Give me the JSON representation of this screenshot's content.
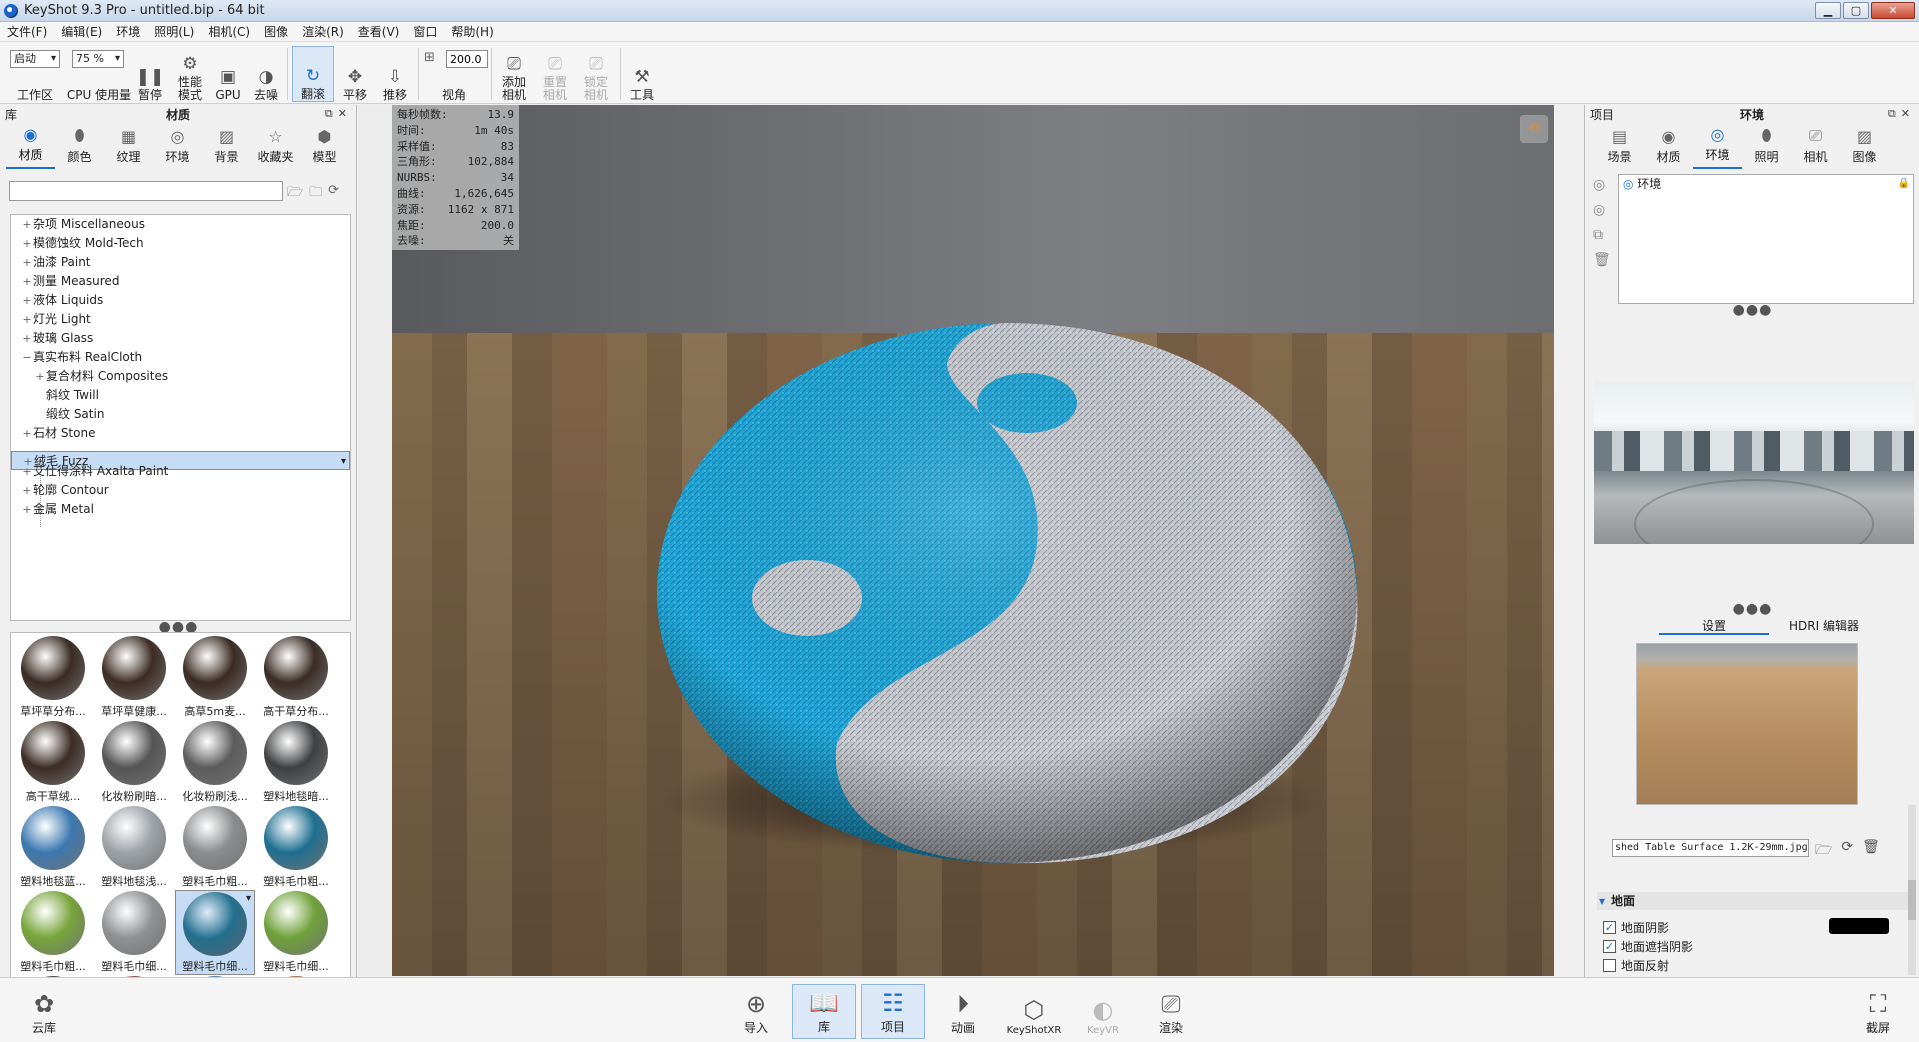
{
  "window": {
    "title": "KeyShot 9.3 Pro  - untitled.bip  - 64 bit",
    "min": "▁",
    "max": "▢",
    "close": "✕"
  },
  "menu": [
    "文件(F)",
    "编辑(E)",
    "环境",
    "照明(L)",
    "相机(C)",
    "图像",
    "渲染(R)",
    "查看(V)",
    "窗口",
    "帮助(H)"
  ],
  "toolbar": {
    "workspace_select": "启动",
    "workspace_label": "工作区",
    "cpu_select": "75 %",
    "cpu_label": "CPU 使用量",
    "pause": "暂停",
    "perf_mode": "性能\n模式",
    "gpu": "GPU",
    "denoise": "去噪",
    "tumble": "翻滚",
    "pan": "平移",
    "dolly": "推移",
    "fov_value": "200.0",
    "fov_label": "视角",
    "add_camera": "添加\n相机",
    "reset_camera": "重置\n相机",
    "lock_camera": "锁定\n相机",
    "tools": "工具"
  },
  "library": {
    "left_label": "库",
    "title": "材质",
    "tabs": [
      "材质",
      "颜色",
      "纹理",
      "环境",
      "背景",
      "收藏夹",
      "模型"
    ],
    "search_placeholder": "",
    "tree": [
      {
        "label": "杂项 Miscellaneous",
        "pm": "+",
        "indent": 0
      },
      {
        "label": "模德蚀纹 Mold-Tech",
        "pm": "+",
        "indent": 0
      },
      {
        "label": "油漆 Paint",
        "pm": "+",
        "indent": 0
      },
      {
        "label": "测量 Measured",
        "pm": "+",
        "indent": 0
      },
      {
        "label": "液体 Liquids",
        "pm": "+",
        "indent": 0
      },
      {
        "label": "灯光 Light",
        "pm": "+",
        "indent": 0
      },
      {
        "label": "玻璃 Glass",
        "pm": "+",
        "indent": 0
      },
      {
        "label": "真实布料 RealCloth",
        "pm": "−",
        "indent": 0
      },
      {
        "label": "复合材料 Composites",
        "pm": "+",
        "indent": 1
      },
      {
        "label": "斜纹 Twill",
        "pm": "",
        "indent": 1
      },
      {
        "label": "缎纹 Satin",
        "pm": "",
        "indent": 1
      },
      {
        "label": "石材 Stone",
        "pm": "+",
        "indent": 0
      },
      {
        "label": "绒毛 Fuzz",
        "pm": "+",
        "indent": 0,
        "selected": true
      },
      {
        "label": "艾仕得涂料 Axalta Paint",
        "pm": "+",
        "indent": 0
      },
      {
        "label": "轮廓 Contour",
        "pm": "+",
        "indent": 0
      },
      {
        "label": "金属 Metal",
        "pm": "+",
        "indent": 0
      }
    ],
    "thumbnails": [
      {
        "label": "草坪草分布...",
        "color": "#3a2b24"
      },
      {
        "label": "草坪草健康...",
        "color": "#3d2c24"
      },
      {
        "label": "高草5m麦...",
        "color": "#3a2a22"
      },
      {
        "label": "高干草分布...",
        "color": "#3b2c25"
      },
      {
        "label": "高干草绒...",
        "color": "#3c2d26"
      },
      {
        "label": "化妆粉刷暗...",
        "color": "#555555"
      },
      {
        "label": "化妆粉刷浅...",
        "color": "#5c5c5c"
      },
      {
        "label": "塑料地毯暗...",
        "color": "#3f4042"
      },
      {
        "label": "塑料地毯蓝...",
        "color": "#3b78b0"
      },
      {
        "label": "塑料地毯浅...",
        "color": "#9ea3a8"
      },
      {
        "label": "塑料毛巾粗...",
        "color": "#8a8c8e"
      },
      {
        "label": "塑料毛巾粗...",
        "color": "#1e6f91"
      },
      {
        "label": "塑料毛巾粗...",
        "color": "#77a53a"
      },
      {
        "label": "塑料毛巾细...",
        "color": "#8f9193"
      },
      {
        "label": "塑料毛巾细...",
        "color": "#236f8e",
        "selected": true
      },
      {
        "label": "塑料毛巾细...",
        "color": "#6fa13a"
      },
      {
        "label": "",
        "color": "#2a2b2d"
      },
      {
        "label": "",
        "color": "#7a2d35"
      },
      {
        "label": "",
        "color": "#2a6f86"
      },
      {
        "label": "",
        "color": "#7d5c28"
      }
    ]
  },
  "stats": [
    {
      "k": "每秒帧数:",
      "v": "13.9"
    },
    {
      "k": "时间:",
      "v": "1m 40s"
    },
    {
      "k": "采样值:",
      "v": "83"
    },
    {
      "k": "三角形:",
      "v": "102,884"
    },
    {
      "k": "NURBS:",
      "v": "34"
    },
    {
      "k": "曲线:",
      "v": "1,626,645"
    },
    {
      "k": "资源:",
      "v": "1162 x 871"
    },
    {
      "k": "焦距:",
      "v": "200.0"
    },
    {
      "k": "去噪:",
      "v": "关"
    }
  ],
  "project": {
    "left_label": "项目",
    "title": "环境",
    "tabs": [
      "场景",
      "材质",
      "环境",
      "照明",
      "相机",
      "图像"
    ],
    "list": [
      {
        "label": "环境"
      }
    ],
    "subtabs": [
      "设置",
      "HDRI 编辑器"
    ],
    "bg_file": "shed Table Surface 1.2K-29mm.jpg",
    "ground_section": "地面",
    "checks": [
      {
        "label": "地面阴影",
        "checked": true
      },
      {
        "label": "地面遮挡阴影",
        "checked": true
      },
      {
        "label": "地面反射",
        "checked": false
      }
    ],
    "shadow_color": "#000000"
  },
  "bottom": {
    "cloud": "云库",
    "import": "导入",
    "library": "库",
    "project": "项目",
    "animation": "动画",
    "keyshotxr": "KeyShotXR",
    "keyvr": "KeyVR",
    "render": "渲染",
    "screenshot": "截屏"
  },
  "colors": {
    "accent": "#1a6fd1",
    "blue_fuzz": "#1da7d8",
    "gray_fuzz": "#c9ccd2"
  }
}
